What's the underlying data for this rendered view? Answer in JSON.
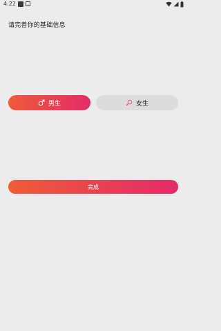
{
  "status_bar": {
    "time": "4:22",
    "icons": [
      "app-square-icon",
      "notification-icon",
      "wifi-icon",
      "signal-icon",
      "battery-icon"
    ]
  },
  "page": {
    "title": "请完善你的基础信息"
  },
  "gender": {
    "selected": "male",
    "male_label": "男生",
    "female_label": "女生",
    "male_icon": "male-symbol-icon",
    "female_icon": "female-symbol-icon"
  },
  "actions": {
    "submit_label": "完成"
  },
  "colors": {
    "background": "#ececec",
    "gradient_start": "#ef5a3a",
    "gradient_end": "#e32b68",
    "unselected": "#dcdcdc",
    "female_icon_color": "#e8567a"
  }
}
